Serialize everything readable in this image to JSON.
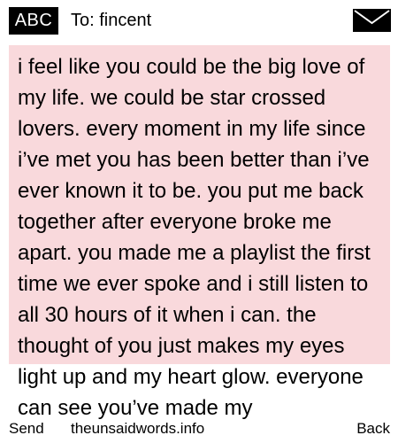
{
  "header": {
    "badge_label": "ABC",
    "to_label": "To: fincent",
    "mail_icon": "envelope-icon"
  },
  "message": {
    "background_color": "#f9d9dc",
    "text": "i feel like you could be the big love of my life. we could be star crossed lovers. every moment in my life since i’ve met you has been better than i’ve ever known it to be. you put me back together after everyone broke me apart. you made me a playlist the first time we ever spoke and i still listen to all 30 hours of it when i can. the thought of you just makes my eyes light up and my heart glow. everyone can see you’ve made my"
  },
  "footer": {
    "send_label": "Send",
    "site_label": "theunsaidwords.info",
    "back_label": "Back"
  }
}
